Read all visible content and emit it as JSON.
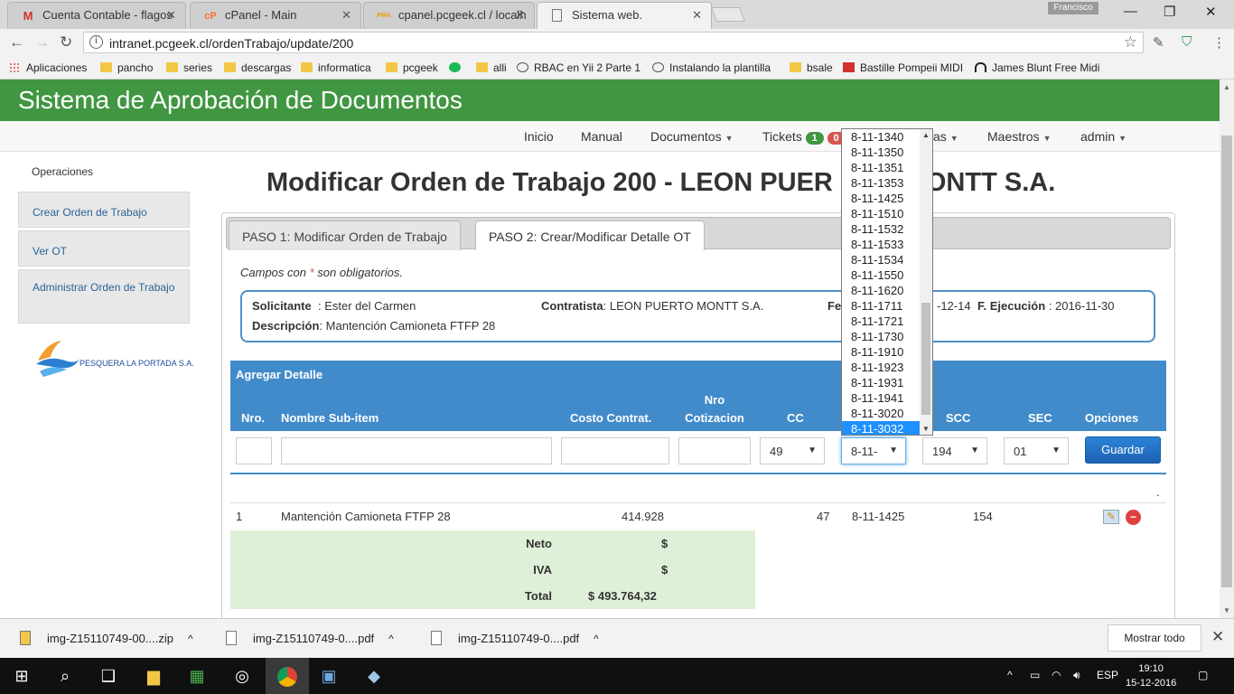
{
  "browser": {
    "tabs": [
      {
        "title": "Cuenta Contable - flagos",
        "icon": "M"
      },
      {
        "title": "cPanel - Main",
        "icon": "cP"
      },
      {
        "title": "cpanel.pcgeek.cl / localh",
        "icon": "PMA"
      },
      {
        "title": "Sistema web.",
        "icon": "doc"
      }
    ],
    "user": "Francisco",
    "url": "intranet.pcgeek.cl/ordenTrabajo/update/200",
    "bookmarks": [
      "Aplicaciones",
      "pancho",
      "series",
      "descargas",
      "informatica",
      "pcgeek",
      "",
      "alli",
      "RBAC en Yii 2 Parte 1",
      "Instalando la plantilla",
      "bsale",
      "Bastille Pompeii MIDI",
      "James Blunt Free Midi"
    ]
  },
  "app": {
    "title": "Sistema de Aprobación de Documentos",
    "nav": {
      "inicio": "Inicio",
      "manual": "Manual",
      "documentos": "Documentos",
      "tickets": "Tickets",
      "tickets_badge_green": "1",
      "tickets_badge_red": "0",
      "reportes_partial": "as",
      "maestros": "Maestros",
      "admin": "admin"
    },
    "sidebar": {
      "heading": "Operaciones",
      "items": [
        "Crear Orden de Trabajo",
        "Ver OT",
        "Administrar Orden de Trabajo"
      ],
      "logo_text": "PESQUERA LA PORTADA S.A."
    },
    "page_title": "Modificar Orden de Trabajo 200 - LEON PUERTO MONTT S.A.",
    "page_title_visible_left": "Modificar Orden de Trabajo 200 - LEON PUER",
    "page_title_visible_right": "ONTT S.A.",
    "tabs": [
      "PASO 1: Modificar Orden de Trabajo",
      "PASO 2: Crear/Modificar Detalle OT"
    ],
    "required_note": {
      "prefix": "Campos con ",
      "star": "*",
      "suffix": " son obligatorios."
    },
    "info": {
      "solicitante_label": "Solicitante",
      "solicitante": "Ester del Carmen",
      "contratista_label": "Contratista",
      "contratista": "LEON PUERTO MONTT S.A.",
      "fecha_label_partial": "Fe",
      "fecha_partial": "-12-14",
      "ejecucion_label": "F. Ejecución",
      "ejecucion": "2016-11-30",
      "descripcion_label": "Descripción",
      "descripcion": "Mantención Camioneta FTFP 28"
    },
    "detalle": {
      "header": "Agregar Detalle",
      "columns": {
        "nro": "Nro.",
        "nombre": "Nombre Sub-item",
        "costo": "Costo Contrat.",
        "nro_cot_1": "Nro",
        "nro_cot_2": "Cotizacion",
        "cc": "CC",
        "scc": "SCC",
        "sec": "SEC",
        "opciones": "Opciones"
      },
      "inputs": {
        "cc": "49",
        "sc": "8-11-",
        "scc": "194",
        "sec": "01"
      },
      "save_label": "Guardar",
      "rows": [
        {
          "nro": "1",
          "nombre": "Mantención Camioneta FTFP 28",
          "costo": "414.928",
          "cc": "47",
          "sc": "8-11-1425",
          "scc": "154"
        }
      ],
      "totals": [
        {
          "label": "Neto",
          "currency": "$",
          "value": ""
        },
        {
          "label": "IVA",
          "currency": "$",
          "value": ""
        },
        {
          "label": "Total",
          "currency": "",
          "value": "$ 493.764,32"
        }
      ],
      "dot": "."
    },
    "dropdown_options": [
      "8-11-1340",
      "8-11-1350",
      "8-11-1351",
      "8-11-1353",
      "8-11-1425",
      "8-11-1510",
      "8-11-1532",
      "8-11-1533",
      "8-11-1534",
      "8-11-1550",
      "8-11-1620",
      "8-11-1711",
      "8-11-1721",
      "8-11-1730",
      "8-11-1910",
      "8-11-1923",
      "8-11-1931",
      "8-11-1941",
      "8-11-3020",
      "8-11-3032"
    ],
    "dropdown_selected": "8-11-3032"
  },
  "downloads": {
    "files": [
      "img-Z15110749-00....zip",
      "img-Z15110749-0....pdf",
      "img-Z15110749-0....pdf"
    ],
    "show_all": "Mostrar todo"
  },
  "taskbar": {
    "lang": "ESP",
    "time": "19:10",
    "date": "15-12-2016"
  },
  "colors": {
    "banner": "#419641",
    "primary": "#428bca",
    "totals_bg": "#dff0d8",
    "danger": "#d9534f"
  }
}
